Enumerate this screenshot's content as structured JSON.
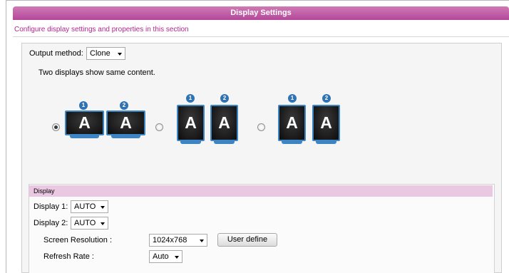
{
  "header": {
    "title": "Display Settings"
  },
  "subtitle": "Configure display settings and properties in this section",
  "output": {
    "label": "Output method:",
    "value": "Clone",
    "description": "Two displays show same content."
  },
  "layouts": {
    "options": [
      {
        "selected": true,
        "monitors": [
          {
            "num": "1",
            "glyph": "A"
          },
          {
            "num": "2",
            "glyph": "A"
          }
        ]
      },
      {
        "selected": false,
        "monitors": [
          {
            "num": "1",
            "glyph": "A"
          },
          {
            "num": "2",
            "glyph": "A"
          }
        ]
      },
      {
        "selected": false,
        "monitors": [
          {
            "num": "1",
            "glyph": "A"
          },
          {
            "num": "2",
            "glyph": "A"
          }
        ]
      }
    ]
  },
  "display": {
    "section_title": "Display",
    "display1_label": "Display 1:",
    "display1_value": "AUTO",
    "display2_label": "Display 2:",
    "display2_value": "AUTO",
    "resolution_label": "Screen Resolution :",
    "resolution_value": "1024x768",
    "user_define_label": "User define",
    "refresh_label": "Refresh Rate :",
    "refresh_value": "Auto"
  },
  "colors": {
    "title_bar": "#b4479a",
    "section_bar": "#ebc8e2",
    "accent_text": "#b1278f",
    "monitor_frame": "#3c84c3",
    "badge": "#2f73b3"
  },
  "icons": {
    "dropdown": "chevron-down-icon",
    "monitor": "monitor-icon",
    "badge": "number-badge-icon"
  }
}
